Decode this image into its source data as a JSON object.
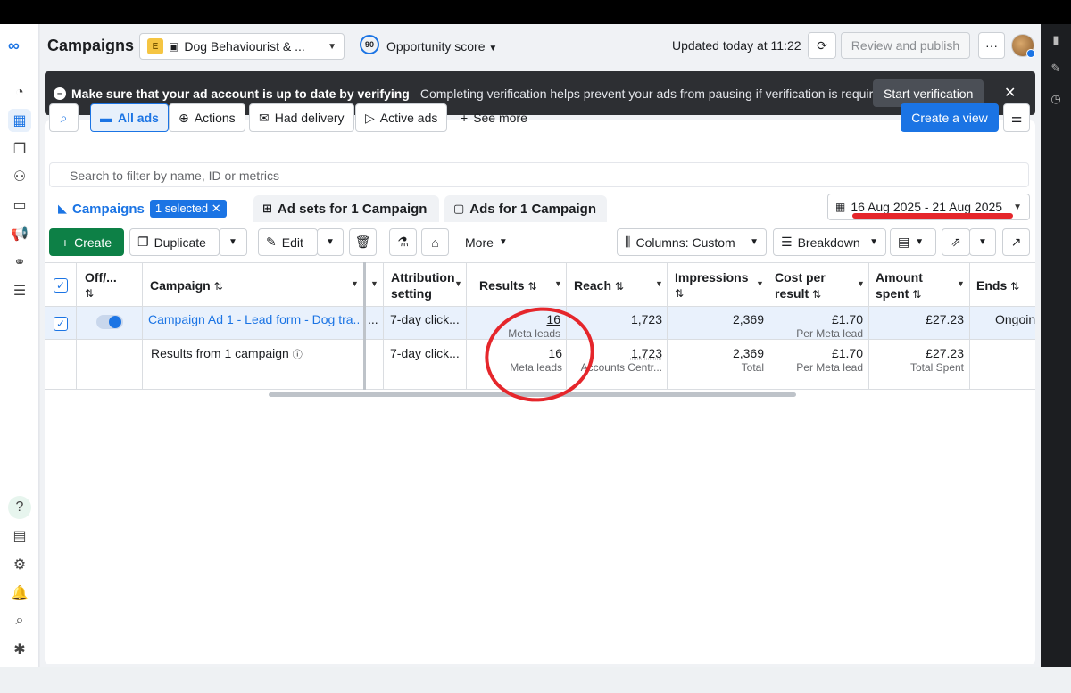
{
  "header": {
    "title": "Campaigns",
    "account_badge": "E",
    "account_name": "Dog Behaviourist & ...",
    "opportunity_score": "90",
    "opportunity_label": "Opportunity score",
    "updated": "Updated today at 11:22",
    "review_publish": "Review and publish",
    "more": "···"
  },
  "banner": {
    "title": "Make sure that your ad account is up to date by verifying",
    "text": "Completing verification helps prevent your ads from pausing if verification is requir...",
    "button": "Start verification",
    "close": "✕"
  },
  "filters": {
    "all_ads": "All ads",
    "actions": "Actions",
    "had_delivery": "Had delivery",
    "active_ads": "Active ads",
    "see_more": "See more",
    "create_view": "Create a view",
    "search_placeholder": "Search to filter by name, ID or metrics"
  },
  "tabs": {
    "campaigns": "Campaigns",
    "selected": "1 selected",
    "ad_sets": "Ad sets for 1 Campaign",
    "ads": "Ads for 1 Campaign"
  },
  "date_range": "16 Aug 2025 - 21 Aug 2025",
  "toolbar": {
    "create": "Create",
    "duplicate": "Duplicate",
    "edit": "Edit",
    "more": "More",
    "columns": "Columns: Custom",
    "breakdown": "Breakdown"
  },
  "table": {
    "headers": {
      "off_on": "Off/...",
      "campaign": "Campaign",
      "attribution": "Attribution",
      "attribution2": "setting",
      "results": "Results",
      "reach": "Reach",
      "impressions": "Impressions",
      "cost_per": "Cost per",
      "cost_per2": "result",
      "amount": "Amount",
      "amount2": "spent",
      "ends": "Ends"
    },
    "row1": {
      "campaign": "Campaign Ad 1 - Lead form - Dog tra...",
      "ellipsis": "...",
      "attribution": "7-day click...",
      "results": "16",
      "results_sub": "Meta leads",
      "reach": "1,723",
      "impressions": "2,369",
      "cost": "£1.70",
      "cost_sub": "Per Meta lead",
      "amount": "£27.23",
      "ends": "Ongoin"
    },
    "row2": {
      "label": "Results from 1 campaign",
      "attribution": "7-day click...",
      "results": "16",
      "results_sub": "Meta leads",
      "reach": "1,723",
      "reach_sub": "Accounts Centr...",
      "impressions": "2,369",
      "impressions_sub": "Total",
      "cost": "£1.70",
      "cost_sub": "Per Meta lead",
      "amount": "£27.23",
      "amount_sub": "Total Spent"
    }
  },
  "colors": {
    "accent": "#1b74e4",
    "annotation": "#e5262b",
    "create_green": "#0d8046"
  }
}
